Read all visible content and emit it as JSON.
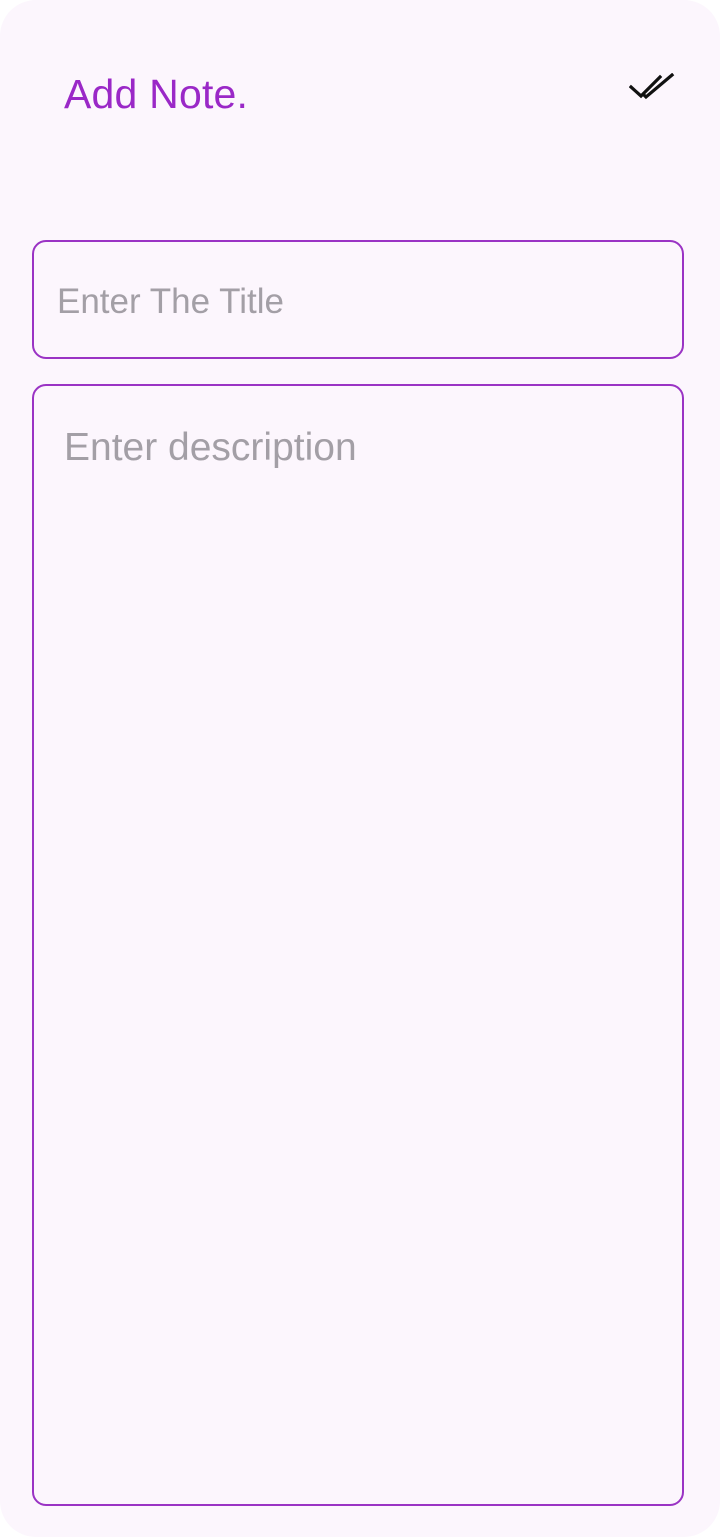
{
  "header": {
    "title": "Add Note.",
    "save_icon": "double-check-icon"
  },
  "form": {
    "title_placeholder": "Enter The Title",
    "title_value": "",
    "description_placeholder": "Enter description",
    "description_value": ""
  },
  "colors": {
    "accent": "#9a28c7",
    "border": "#9a33c4",
    "background": "#fcf6fd",
    "placeholder": "#a39fa6",
    "icon": "#111111"
  }
}
